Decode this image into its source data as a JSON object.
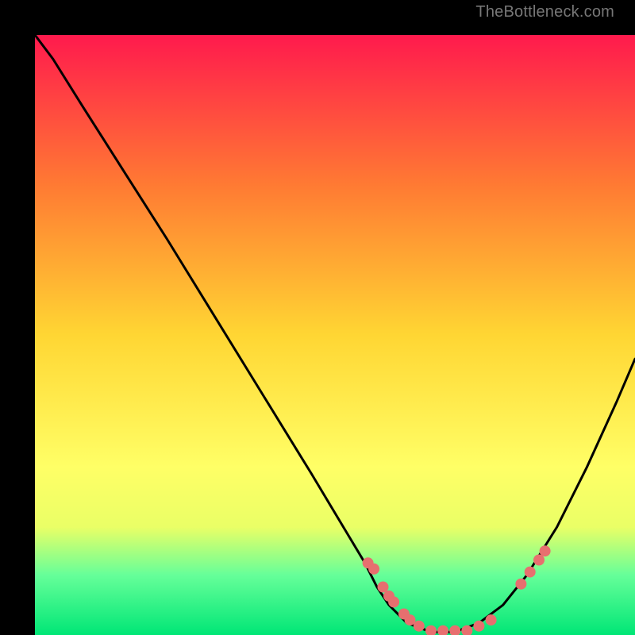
{
  "watermark": "TheBottleneck.com",
  "chart_data": {
    "type": "line",
    "title": "",
    "xlabel": "",
    "ylabel": "",
    "xlim": [
      0,
      100
    ],
    "ylim": [
      0,
      100
    ],
    "background_gradient": {
      "stops": [
        {
          "offset": 0,
          "color": "#ff1a4d"
        },
        {
          "offset": 25,
          "color": "#ff7a33"
        },
        {
          "offset": 50,
          "color": "#ffd633"
        },
        {
          "offset": 72,
          "color": "#ffff66"
        },
        {
          "offset": 82,
          "color": "#eaff66"
        },
        {
          "offset": 90,
          "color": "#66ff99"
        },
        {
          "offset": 100,
          "color": "#00e676"
        }
      ]
    },
    "series": [
      {
        "name": "bottleneck-curve",
        "x": [
          0,
          3,
          8,
          15,
          22,
          30,
          38,
          46,
          52,
          55,
          57,
          59,
          62,
          66,
          70,
          74,
          78,
          82,
          87,
          92,
          97,
          100
        ],
        "y": [
          100,
          96,
          88,
          77,
          66,
          53,
          40,
          27,
          17,
          12,
          8,
          5,
          2,
          0.5,
          0.5,
          2,
          5,
          10,
          18,
          28,
          39,
          46
        ]
      }
    ],
    "markers": {
      "name": "highlight-points",
      "color": "#e76f6f",
      "x": [
        55.5,
        56.5,
        58,
        59,
        59.8,
        61.5,
        62.5,
        64,
        66,
        68,
        70,
        72,
        74,
        76,
        81,
        82.5,
        84,
        85
      ],
      "y": [
        12,
        11,
        8,
        6.5,
        5.5,
        3.5,
        2.5,
        1.5,
        0.7,
        0.7,
        0.7,
        0.7,
        1.5,
        2.5,
        8.5,
        10.5,
        12.5,
        14
      ]
    }
  }
}
